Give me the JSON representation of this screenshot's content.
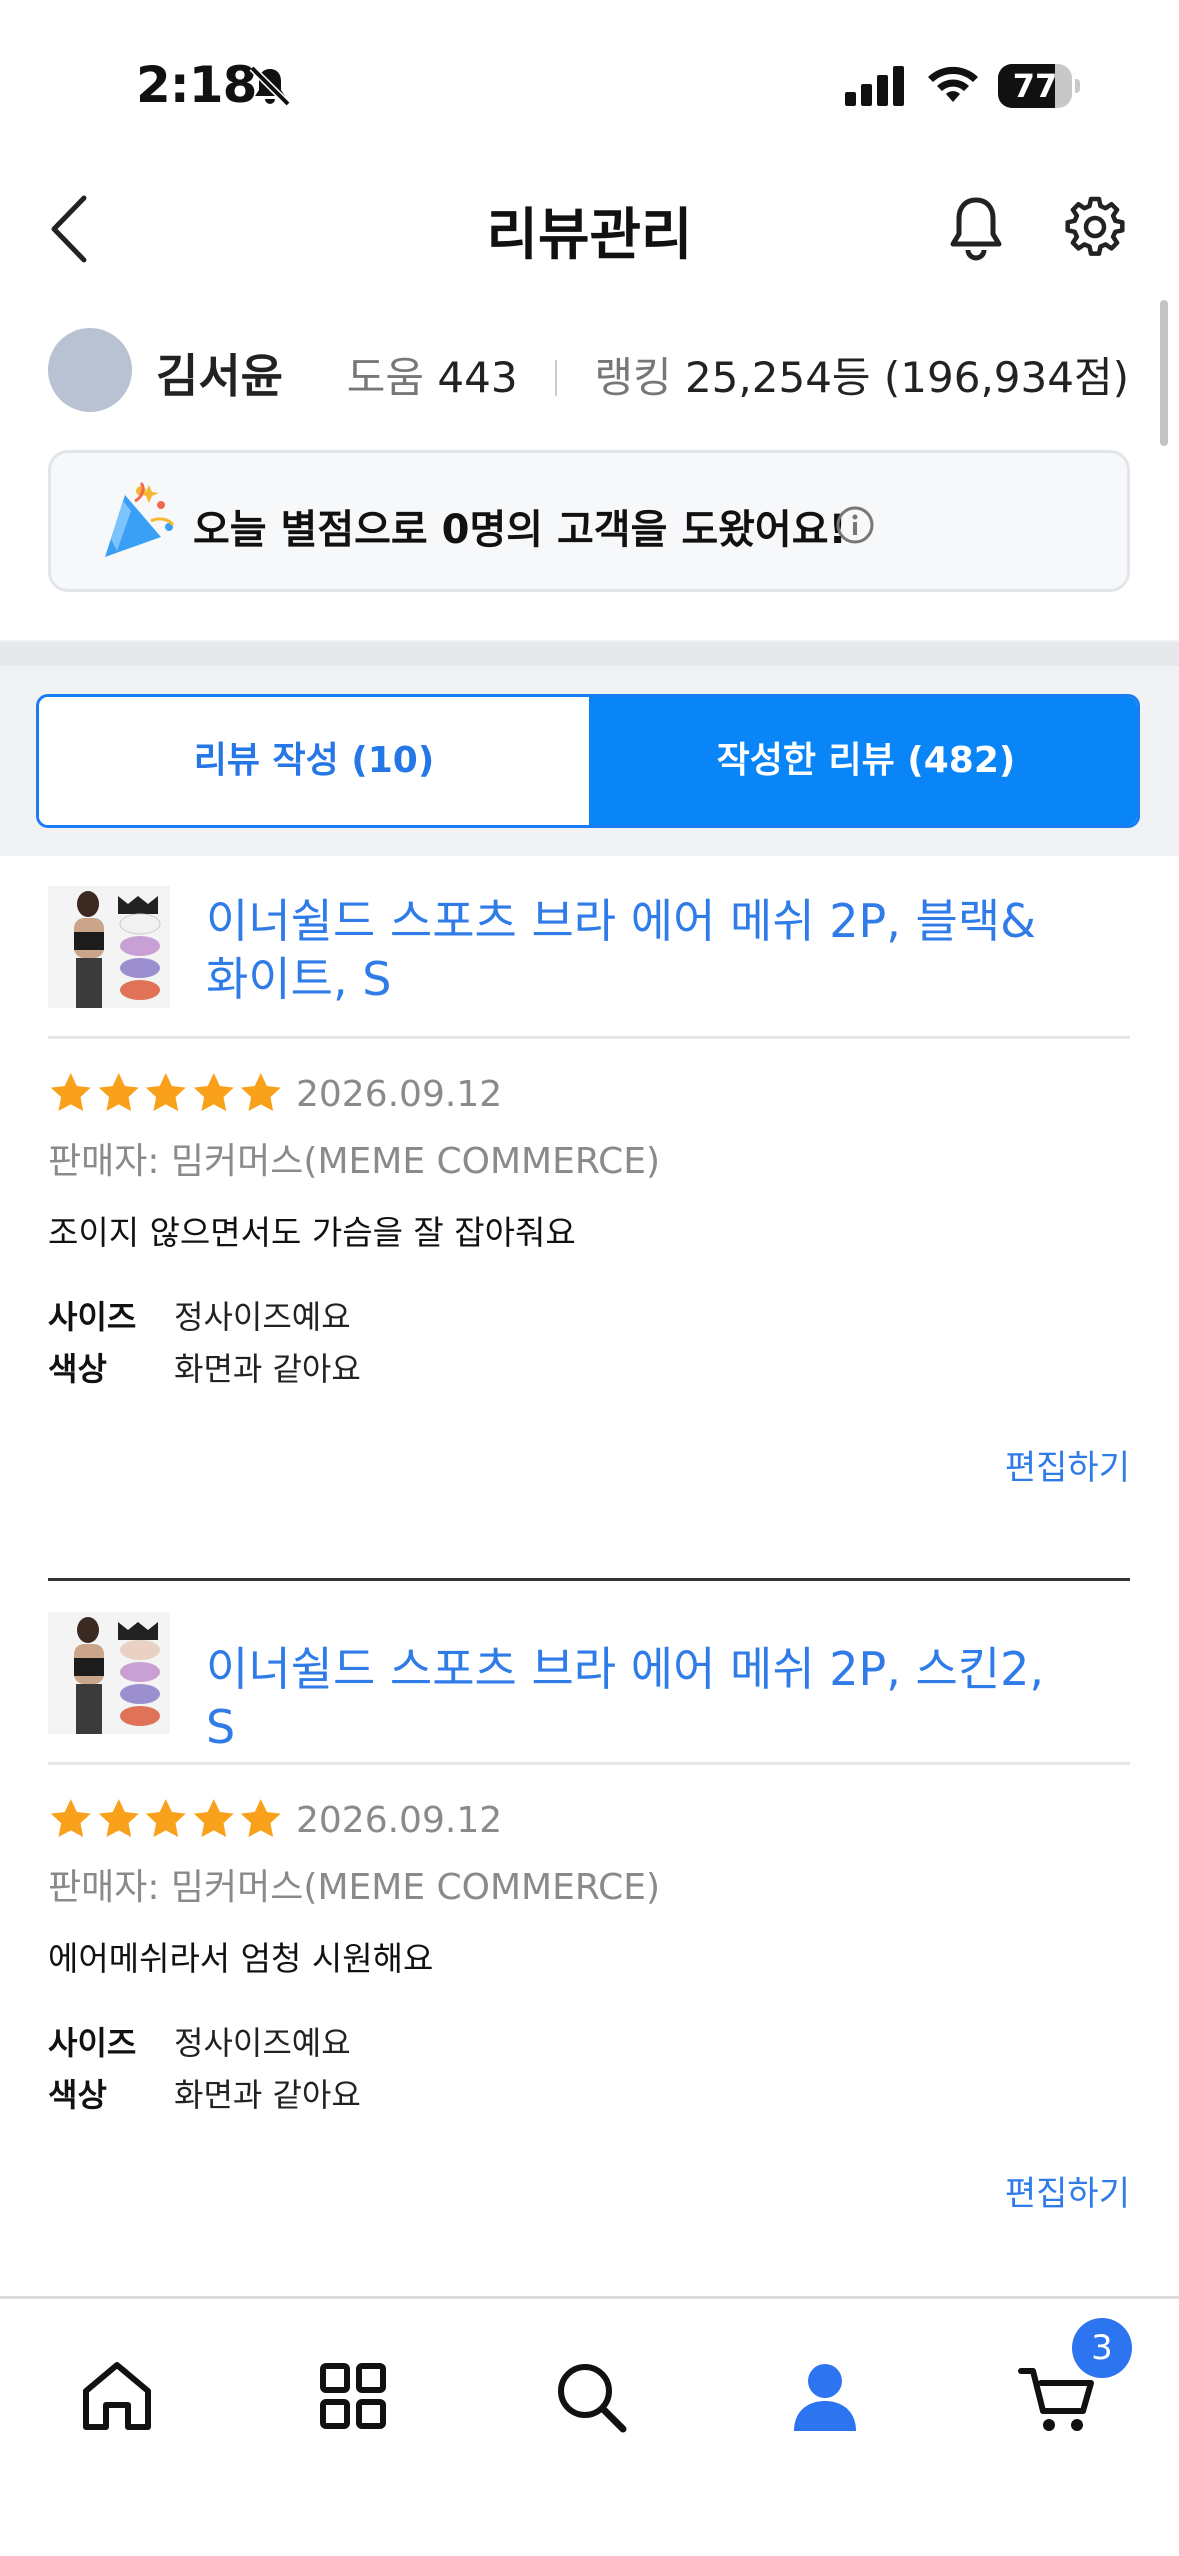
{
  "status_bar": {
    "time": "2:18",
    "battery": "77"
  },
  "header": {
    "title": "리뷰관리"
  },
  "profile": {
    "name": "김서윤",
    "help_label": "도움",
    "help_count": "443",
    "ranking_label": "랭킹",
    "ranking_value": "25,254등 (196,934점)"
  },
  "notice": {
    "text": "오늘 별점으로 0명의 고객을 도왔어요!"
  },
  "tabs": [
    {
      "label": "리뷰 작성 (10)",
      "active": false
    },
    {
      "label": "작성한 리뷰 (482)",
      "active": true
    }
  ],
  "reviews": [
    {
      "title_line1": "이너쉴드 스포츠 브라 에어 메쉬 2P, 블랙&",
      "title_line2": "화이트, S",
      "rating": 5,
      "date": "2026.09.12",
      "seller": "판매자: 밈커머스(MEME COMMERCE)",
      "body": "조이지 않으면서도 가슴을 잘 잡아줘요",
      "attributes": [
        {
          "key": "사이즈",
          "value": "정사이즈예요"
        },
        {
          "key": "색상",
          "value": "화면과 같아요"
        }
      ],
      "edit_label": "편집하기"
    },
    {
      "title_line1": "이너쉴드 스포츠 브라 에어 메쉬 2P, 스킨2, S",
      "rating": 5,
      "date": "2026.09.12",
      "seller": "판매자: 밈커머스(MEME COMMERCE)",
      "body": "에어메쉬라서 엄청 시원해요",
      "attributes": [
        {
          "key": "사이즈",
          "value": "정사이즈예요"
        },
        {
          "key": "색상",
          "value": "화면과 같아요"
        }
      ],
      "edit_label": "편집하기"
    }
  ],
  "bottom_nav": {
    "items": [
      "home-icon",
      "category-icon",
      "search-icon",
      "user-icon",
      "cart-icon"
    ],
    "active": "user-icon",
    "cart_badge": "3"
  },
  "colors": {
    "accent": "#0a85f7",
    "link": "#2f7be8",
    "star": "#f9a11b"
  }
}
